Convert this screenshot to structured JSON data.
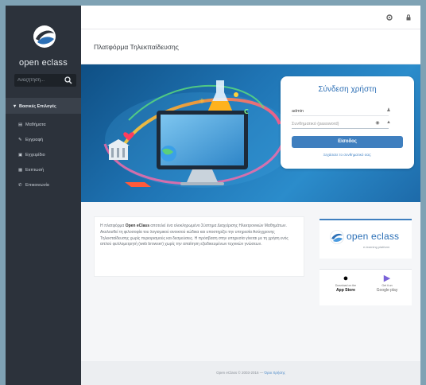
{
  "sidebar": {
    "logo_text": "open eclass",
    "search_placeholder": "Αναζήτηση...",
    "nav_heading": "Βασικές Επιλογές",
    "items": [
      {
        "icon": "book-icon",
        "label": "Μαθήματα"
      },
      {
        "icon": "edit-icon",
        "label": "Εγγραφή"
      },
      {
        "icon": "manual-icon",
        "label": "Εγχειρίδιο"
      },
      {
        "icon": "calendar-icon",
        "label": "Εκπτωσή"
      },
      {
        "icon": "phone-icon",
        "label": "Επικοινωνία"
      }
    ]
  },
  "topbar": {
    "icons": [
      "settings-icon",
      "lock-icon"
    ]
  },
  "page": {
    "title": "Πλατφόρμα Τηλεκπαίδευσης"
  },
  "login": {
    "title": "Σύνδεση χρήστη",
    "username_value": "admin",
    "password_placeholder": "Συνθηματικό (password)",
    "submit_label": "Είσοδος",
    "forgot_link": "Ξεχάσατε το συνθηματικό σας;"
  },
  "description": {
    "prefix": "Η πλατφόρμα ",
    "brand": "Open eClass",
    "body": " αποτελεί ένα ολοκληρωμένο Σύστημα Διαχείρισης Ηλεκτρονικών Μαθημάτων. Ακολουθεί τη φιλοσοφία του λογισμικού ανοικτού κώδικα και υποστηρίζει την υπηρεσία Ασύγχρονης Τηλεκπαίδευσης χωρίς περιορισμούς και δεσμεύσεις. Η πρόσβαση στην υπηρεσία γίνεται με τη χρήση ενός απλού φυλλομετρητή (web browser) χωρίς την απαίτηση εξειδικευμένων τεχνικών γνώσεων."
  },
  "brand_panel": {
    "name": "open eclass",
    "tagline": "e-learning platform"
  },
  "stores": {
    "apple_small": "Download on the",
    "apple_big": "App Store",
    "google_small": "Get it on",
    "google_big": "Google play"
  },
  "footer": {
    "text": "Open eClass © 2003-2016 — ",
    "link": "Όροι Χρήσης"
  },
  "colors": {
    "accent": "#3f7fbf",
    "sidebar": "#2c323b",
    "hero_start": "#0f4f84",
    "hero_end": "#2b8ccb"
  }
}
